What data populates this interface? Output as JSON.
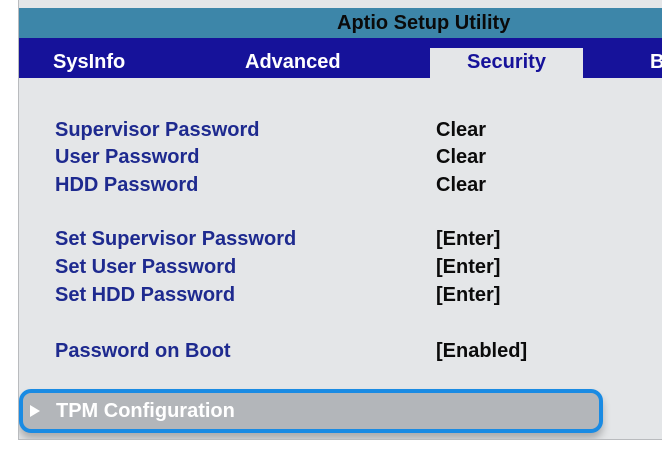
{
  "header": {
    "title": "Aptio Setup Utility"
  },
  "tabs": [
    {
      "label": "SysInfo"
    },
    {
      "label": "Advanced"
    },
    {
      "label": "Security",
      "active": true
    },
    {
      "label": "B"
    }
  ],
  "security": {
    "supervisor_password": {
      "label": "Supervisor Password",
      "value": "Clear"
    },
    "user_password": {
      "label": "User Password",
      "value": "Clear"
    },
    "hdd_password": {
      "label": "HDD Password",
      "value": "Clear"
    },
    "set_supervisor_password": {
      "label": "Set Supervisor Password",
      "value": "[Enter]"
    },
    "set_user_password": {
      "label": "Set User Password",
      "value": "[Enter]"
    },
    "set_hdd_password": {
      "label": "Set HDD Password",
      "value": "[Enter]"
    },
    "password_on_boot": {
      "label": "Password on Boot",
      "value": "[Enabled]"
    },
    "tpm_configuration": {
      "label": "TPM Configuration",
      "icon": "submenu-arrow-icon"
    }
  },
  "colors": {
    "title_bar": "#3d86a9",
    "tab_bar": "#16129a",
    "panel_bg": "#e4e6e8",
    "label_blue": "#1e2a8f",
    "highlight_border": "#1a8be3",
    "highlight_bg": "#b3b6ba"
  }
}
